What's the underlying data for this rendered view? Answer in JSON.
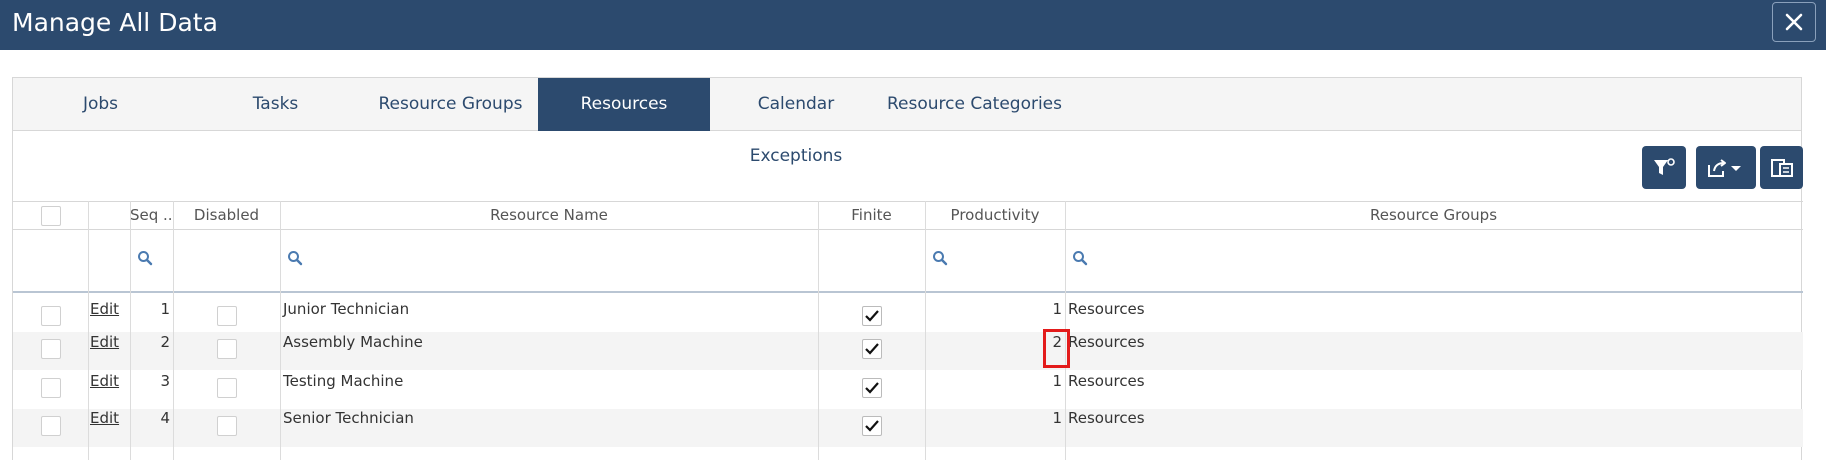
{
  "window": {
    "title": "Manage All Data",
    "close_icon": "close-icon"
  },
  "tabs": [
    {
      "label": "Jobs",
      "active": false
    },
    {
      "label": "Tasks",
      "active": false
    },
    {
      "label": "Resource Groups",
      "active": false
    },
    {
      "label": "Resources",
      "active": true
    },
    {
      "label": "Calendar Exceptions",
      "active": false
    },
    {
      "label": "Resource Categories",
      "active": false
    }
  ],
  "toolbar": {
    "buttons": [
      "filter-clear-icon",
      "export-dropdown-icon",
      "column-chooser-icon"
    ]
  },
  "table": {
    "columns": [
      "",
      "",
      "Seq ...",
      "Disabled",
      "Resource Name",
      "Finite",
      "Productivity",
      "Resource Groups"
    ],
    "edit_label": "Edit",
    "rows": [
      {
        "seq": "1",
        "disabled": false,
        "name": "Junior Technician",
        "finite": true,
        "productivity": "1",
        "groups": "Resources"
      },
      {
        "seq": "2",
        "disabled": false,
        "name": "Assembly Machine",
        "finite": true,
        "productivity": "2",
        "groups": "Resources"
      },
      {
        "seq": "3",
        "disabled": false,
        "name": "Testing Machine",
        "finite": true,
        "productivity": "1",
        "groups": "Resources"
      },
      {
        "seq": "4",
        "disabled": false,
        "name": "Senior Technician",
        "finite": true,
        "productivity": "1",
        "groups": "Resources"
      }
    ]
  },
  "highlight": {
    "row": 1,
    "column": "productivity",
    "color": "#e31b1b"
  },
  "colors": {
    "primary": "#2c4a6e",
    "highlight": "#e31b1b"
  }
}
